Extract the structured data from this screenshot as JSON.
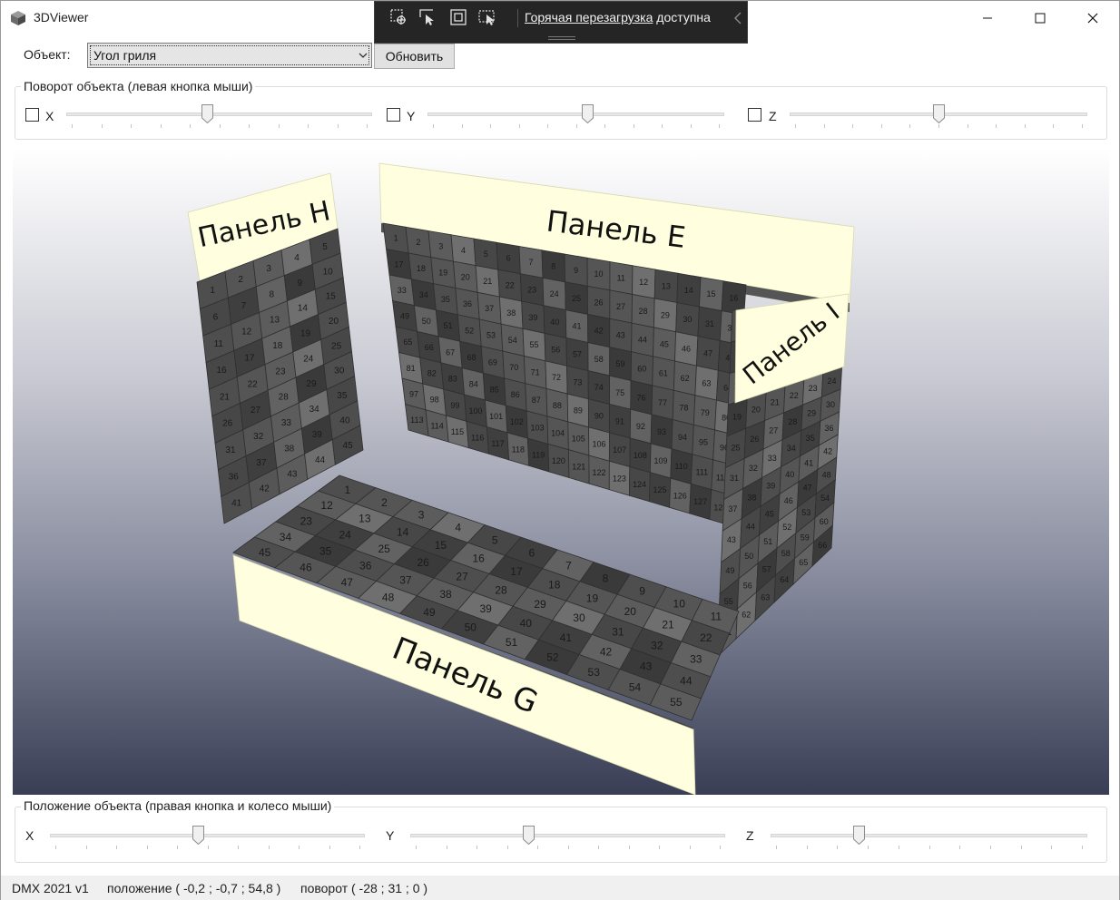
{
  "window": {
    "title": "3DViewer",
    "controls": {
      "minimize": "minimize",
      "maximize": "maximize",
      "close": "close"
    }
  },
  "hot_reload": {
    "tools": [
      "select-element-icon",
      "pointer-icon",
      "frame-icon",
      "track-focus-icon"
    ],
    "link_text": "Горячая перезагрузка",
    "rest_text": " доступна"
  },
  "object_row": {
    "label": "Объект:",
    "selected": "Угол гриля",
    "refresh_label": "Обновить"
  },
  "rotation": {
    "title": "Поворот объекта (левая кнопка мыши)",
    "axes": [
      {
        "label": "X",
        "checked": false,
        "value": 0.46
      },
      {
        "label": "Y",
        "checked": false,
        "value": 0.54
      },
      {
        "label": "Z",
        "checked": false,
        "value": 0.5
      }
    ]
  },
  "scene": {
    "panels": [
      {
        "label": "Панель H",
        "cells": 45
      },
      {
        "label": "Панель E",
        "cells": 132
      },
      {
        "label": "Панель I",
        "cells": 66
      },
      {
        "label": "Панель G",
        "cells": 55
      }
    ],
    "colors": {
      "label_face": "#ffffe0",
      "cell_dark": "#3f3f3f",
      "cell_light": "#6e6e6e",
      "cell_text": "#1a1a1a"
    }
  },
  "position": {
    "title": "Положение объекта (правая кнопка и колесо мыши)",
    "axes": [
      {
        "label": "X",
        "value": 0.47
      },
      {
        "label": "Y",
        "value": 0.37
      },
      {
        "label": "Z",
        "value": 0.27
      }
    ]
  },
  "status": {
    "version": "DMX 2021 v1",
    "position": "положение ( -0,2 ; -0,7 ; 54,8 )",
    "rotation": "поворот ( -28 ; 31 ; 0 )"
  }
}
